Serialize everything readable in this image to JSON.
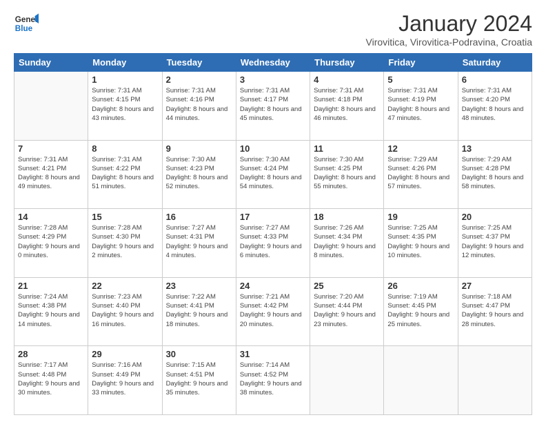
{
  "header": {
    "logo": {
      "general": "General",
      "blue": "Blue"
    },
    "title": "January 2024",
    "subtitle": "Virovitica, Virovitica-Podravina, Croatia"
  },
  "days_of_week": [
    "Sunday",
    "Monday",
    "Tuesday",
    "Wednesday",
    "Thursday",
    "Friday",
    "Saturday"
  ],
  "weeks": [
    [
      {
        "day": "",
        "sunrise": "",
        "sunset": "",
        "daylight": ""
      },
      {
        "day": "1",
        "sunrise": "Sunrise: 7:31 AM",
        "sunset": "Sunset: 4:15 PM",
        "daylight": "Daylight: 8 hours and 43 minutes."
      },
      {
        "day": "2",
        "sunrise": "Sunrise: 7:31 AM",
        "sunset": "Sunset: 4:16 PM",
        "daylight": "Daylight: 8 hours and 44 minutes."
      },
      {
        "day": "3",
        "sunrise": "Sunrise: 7:31 AM",
        "sunset": "Sunset: 4:17 PM",
        "daylight": "Daylight: 8 hours and 45 minutes."
      },
      {
        "day": "4",
        "sunrise": "Sunrise: 7:31 AM",
        "sunset": "Sunset: 4:18 PM",
        "daylight": "Daylight: 8 hours and 46 minutes."
      },
      {
        "day": "5",
        "sunrise": "Sunrise: 7:31 AM",
        "sunset": "Sunset: 4:19 PM",
        "daylight": "Daylight: 8 hours and 47 minutes."
      },
      {
        "day": "6",
        "sunrise": "Sunrise: 7:31 AM",
        "sunset": "Sunset: 4:20 PM",
        "daylight": "Daylight: 8 hours and 48 minutes."
      }
    ],
    [
      {
        "day": "7",
        "sunrise": "Sunrise: 7:31 AM",
        "sunset": "Sunset: 4:21 PM",
        "daylight": "Daylight: 8 hours and 49 minutes."
      },
      {
        "day": "8",
        "sunrise": "Sunrise: 7:31 AM",
        "sunset": "Sunset: 4:22 PM",
        "daylight": "Daylight: 8 hours and 51 minutes."
      },
      {
        "day": "9",
        "sunrise": "Sunrise: 7:30 AM",
        "sunset": "Sunset: 4:23 PM",
        "daylight": "Daylight: 8 hours and 52 minutes."
      },
      {
        "day": "10",
        "sunrise": "Sunrise: 7:30 AM",
        "sunset": "Sunset: 4:24 PM",
        "daylight": "Daylight: 8 hours and 54 minutes."
      },
      {
        "day": "11",
        "sunrise": "Sunrise: 7:30 AM",
        "sunset": "Sunset: 4:25 PM",
        "daylight": "Daylight: 8 hours and 55 minutes."
      },
      {
        "day": "12",
        "sunrise": "Sunrise: 7:29 AM",
        "sunset": "Sunset: 4:26 PM",
        "daylight": "Daylight: 8 hours and 57 minutes."
      },
      {
        "day": "13",
        "sunrise": "Sunrise: 7:29 AM",
        "sunset": "Sunset: 4:28 PM",
        "daylight": "Daylight: 8 hours and 58 minutes."
      }
    ],
    [
      {
        "day": "14",
        "sunrise": "Sunrise: 7:28 AM",
        "sunset": "Sunset: 4:29 PM",
        "daylight": "Daylight: 9 hours and 0 minutes."
      },
      {
        "day": "15",
        "sunrise": "Sunrise: 7:28 AM",
        "sunset": "Sunset: 4:30 PM",
        "daylight": "Daylight: 9 hours and 2 minutes."
      },
      {
        "day": "16",
        "sunrise": "Sunrise: 7:27 AM",
        "sunset": "Sunset: 4:31 PM",
        "daylight": "Daylight: 9 hours and 4 minutes."
      },
      {
        "day": "17",
        "sunrise": "Sunrise: 7:27 AM",
        "sunset": "Sunset: 4:33 PM",
        "daylight": "Daylight: 9 hours and 6 minutes."
      },
      {
        "day": "18",
        "sunrise": "Sunrise: 7:26 AM",
        "sunset": "Sunset: 4:34 PM",
        "daylight": "Daylight: 9 hours and 8 minutes."
      },
      {
        "day": "19",
        "sunrise": "Sunrise: 7:25 AM",
        "sunset": "Sunset: 4:35 PM",
        "daylight": "Daylight: 9 hours and 10 minutes."
      },
      {
        "day": "20",
        "sunrise": "Sunrise: 7:25 AM",
        "sunset": "Sunset: 4:37 PM",
        "daylight": "Daylight: 9 hours and 12 minutes."
      }
    ],
    [
      {
        "day": "21",
        "sunrise": "Sunrise: 7:24 AM",
        "sunset": "Sunset: 4:38 PM",
        "daylight": "Daylight: 9 hours and 14 minutes."
      },
      {
        "day": "22",
        "sunrise": "Sunrise: 7:23 AM",
        "sunset": "Sunset: 4:40 PM",
        "daylight": "Daylight: 9 hours and 16 minutes."
      },
      {
        "day": "23",
        "sunrise": "Sunrise: 7:22 AM",
        "sunset": "Sunset: 4:41 PM",
        "daylight": "Daylight: 9 hours and 18 minutes."
      },
      {
        "day": "24",
        "sunrise": "Sunrise: 7:21 AM",
        "sunset": "Sunset: 4:42 PM",
        "daylight": "Daylight: 9 hours and 20 minutes."
      },
      {
        "day": "25",
        "sunrise": "Sunrise: 7:20 AM",
        "sunset": "Sunset: 4:44 PM",
        "daylight": "Daylight: 9 hours and 23 minutes."
      },
      {
        "day": "26",
        "sunrise": "Sunrise: 7:19 AM",
        "sunset": "Sunset: 4:45 PM",
        "daylight": "Daylight: 9 hours and 25 minutes."
      },
      {
        "day": "27",
        "sunrise": "Sunrise: 7:18 AM",
        "sunset": "Sunset: 4:47 PM",
        "daylight": "Daylight: 9 hours and 28 minutes."
      }
    ],
    [
      {
        "day": "28",
        "sunrise": "Sunrise: 7:17 AM",
        "sunset": "Sunset: 4:48 PM",
        "daylight": "Daylight: 9 hours and 30 minutes."
      },
      {
        "day": "29",
        "sunrise": "Sunrise: 7:16 AM",
        "sunset": "Sunset: 4:49 PM",
        "daylight": "Daylight: 9 hours and 33 minutes."
      },
      {
        "day": "30",
        "sunrise": "Sunrise: 7:15 AM",
        "sunset": "Sunset: 4:51 PM",
        "daylight": "Daylight: 9 hours and 35 minutes."
      },
      {
        "day": "31",
        "sunrise": "Sunrise: 7:14 AM",
        "sunset": "Sunset: 4:52 PM",
        "daylight": "Daylight: 9 hours and 38 minutes."
      },
      {
        "day": "",
        "sunrise": "",
        "sunset": "",
        "daylight": ""
      },
      {
        "day": "",
        "sunrise": "",
        "sunset": "",
        "daylight": ""
      },
      {
        "day": "",
        "sunrise": "",
        "sunset": "",
        "daylight": ""
      }
    ]
  ]
}
